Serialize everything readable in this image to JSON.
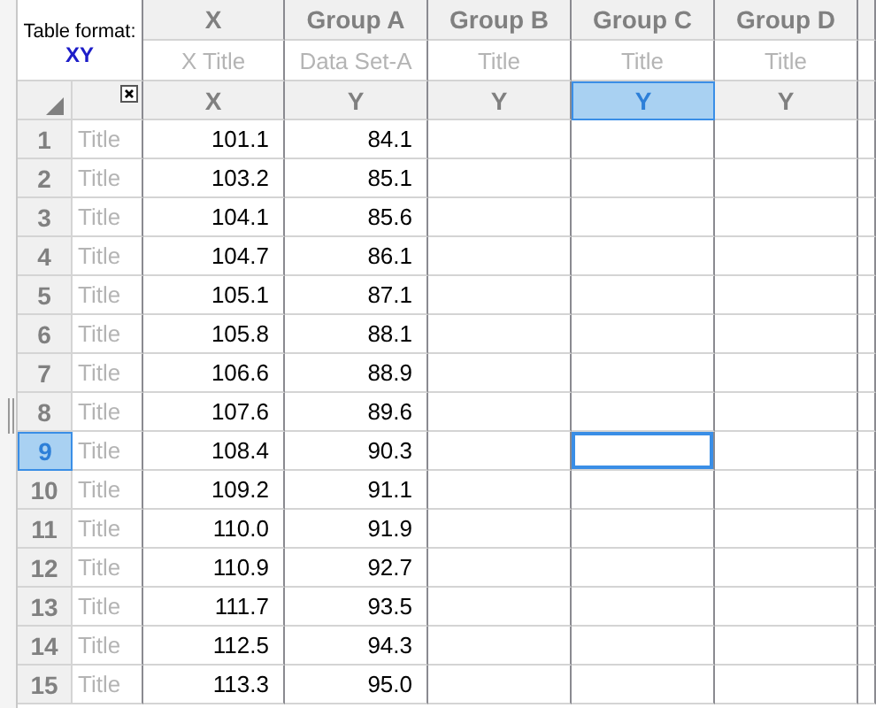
{
  "table_format": {
    "label": "Table format:",
    "value": "XY"
  },
  "columns": [
    {
      "group": "X",
      "title": "X Title",
      "subcolumn": "X",
      "selected": false
    },
    {
      "group": "Group A",
      "title": "Data Set-A",
      "subcolumn": "Y",
      "selected": false
    },
    {
      "group": "Group B",
      "title": "Title",
      "subcolumn": "Y",
      "selected": false
    },
    {
      "group": "Group C",
      "title": "Title",
      "subcolumn": "Y",
      "selected": true
    },
    {
      "group": "Group D",
      "title": "Title",
      "subcolumn": "Y",
      "selected": false
    }
  ],
  "rows": [
    {
      "number": "1",
      "title": "Title",
      "values": [
        "101.1",
        "84.1"
      ],
      "selected": false
    },
    {
      "number": "2",
      "title": "Title",
      "values": [
        "103.2",
        "85.1"
      ],
      "selected": false
    },
    {
      "number": "3",
      "title": "Title",
      "values": [
        "104.1",
        "85.6"
      ],
      "selected": false
    },
    {
      "number": "4",
      "title": "Title",
      "values": [
        "104.7",
        "86.1"
      ],
      "selected": false
    },
    {
      "number": "5",
      "title": "Title",
      "values": [
        "105.1",
        "87.1"
      ],
      "selected": false
    },
    {
      "number": "6",
      "title": "Title",
      "values": [
        "105.8",
        "88.1"
      ],
      "selected": false
    },
    {
      "number": "7",
      "title": "Title",
      "values": [
        "106.6",
        "88.9"
      ],
      "selected": false
    },
    {
      "number": "8",
      "title": "Title",
      "values": [
        "107.6",
        "89.6"
      ],
      "selected": false
    },
    {
      "number": "9",
      "title": "Title",
      "values": [
        "108.4",
        "90.3"
      ],
      "selected": true
    },
    {
      "number": "10",
      "title": "Title",
      "values": [
        "109.2",
        "91.1"
      ],
      "selected": false
    },
    {
      "number": "11",
      "title": "Title",
      "values": [
        "110.0",
        "91.9"
      ],
      "selected": false
    },
    {
      "number": "12",
      "title": "Title",
      "values": [
        "110.9",
        "92.7"
      ],
      "selected": false
    },
    {
      "number": "13",
      "title": "Title",
      "values": [
        "111.7",
        "93.5"
      ],
      "selected": false
    },
    {
      "number": "14",
      "title": "Title",
      "values": [
        "112.5",
        "94.3"
      ],
      "selected": false
    },
    {
      "number": "15",
      "title": "Title",
      "values": [
        "113.3",
        "95.0"
      ],
      "selected": false
    }
  ]
}
